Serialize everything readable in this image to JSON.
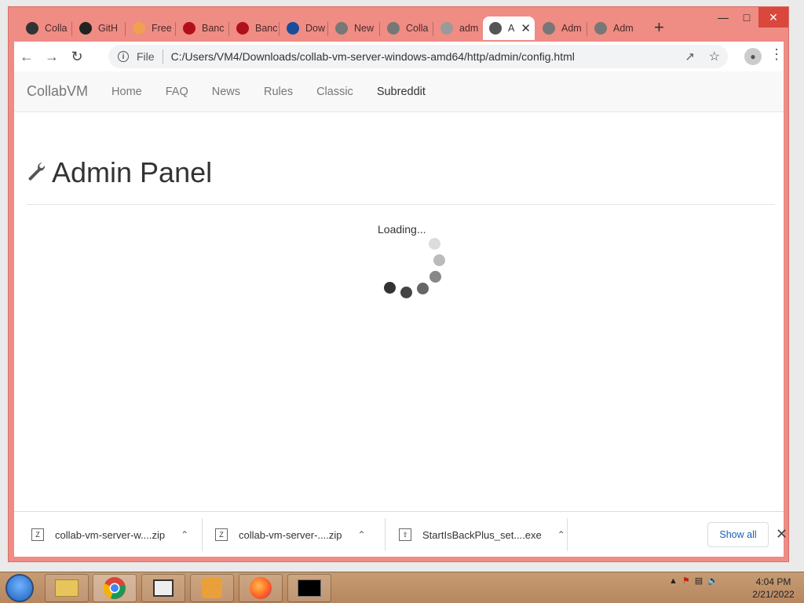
{
  "browser": {
    "tabs": [
      {
        "label": "Colla",
        "icon": "collabvm-icon",
        "color": "#333333"
      },
      {
        "label": "GitH",
        "icon": "github-icon",
        "color": "#222222"
      },
      {
        "label": "Free",
        "icon": "image-icon",
        "color": "#f0a050"
      },
      {
        "label": "Banc",
        "icon": "bandcamp-icon",
        "color": "#b0101a"
      },
      {
        "label": "Banc",
        "icon": "bandcamp-icon",
        "color": "#b0101a"
      },
      {
        "label": "Dow",
        "icon": "download-site-icon",
        "color": "#1a4c9c"
      },
      {
        "label": "New",
        "icon": "chrome-icon",
        "color": "#777777"
      },
      {
        "label": "Colla",
        "icon": "globe-icon",
        "color": "#777777"
      },
      {
        "label": "adm",
        "icon": "globe-icon",
        "color": "#9a9a9a"
      },
      {
        "label": "A",
        "icon": "globe-icon",
        "color": "#555555",
        "active": true
      },
      {
        "label": "Adm",
        "icon": "globe-icon",
        "color": "#777777"
      },
      {
        "label": "Adm",
        "icon": "globe-icon",
        "color": "#777777"
      }
    ],
    "new_tab": "+",
    "address": {
      "scheme": "File",
      "url": "C:/Users/VM4/Downloads/collab-vm-server-windows-amd64/http/admin/config.html"
    }
  },
  "page": {
    "brand": "CollabVM",
    "nav": [
      "Home",
      "FAQ",
      "News",
      "Rules",
      "Classic",
      "Subreddit"
    ],
    "title": "Admin Panel",
    "loading_text": "Loading..."
  },
  "downloads": {
    "items": [
      {
        "name": "collab-vm-server-w....zip"
      },
      {
        "name": "collab-vm-server-....zip"
      },
      {
        "name": "StartIsBackPlus_set....exe"
      }
    ],
    "show_all": "Show all"
  },
  "taskbar": {
    "time": "4:04 PM",
    "date": "2/21/2022"
  }
}
